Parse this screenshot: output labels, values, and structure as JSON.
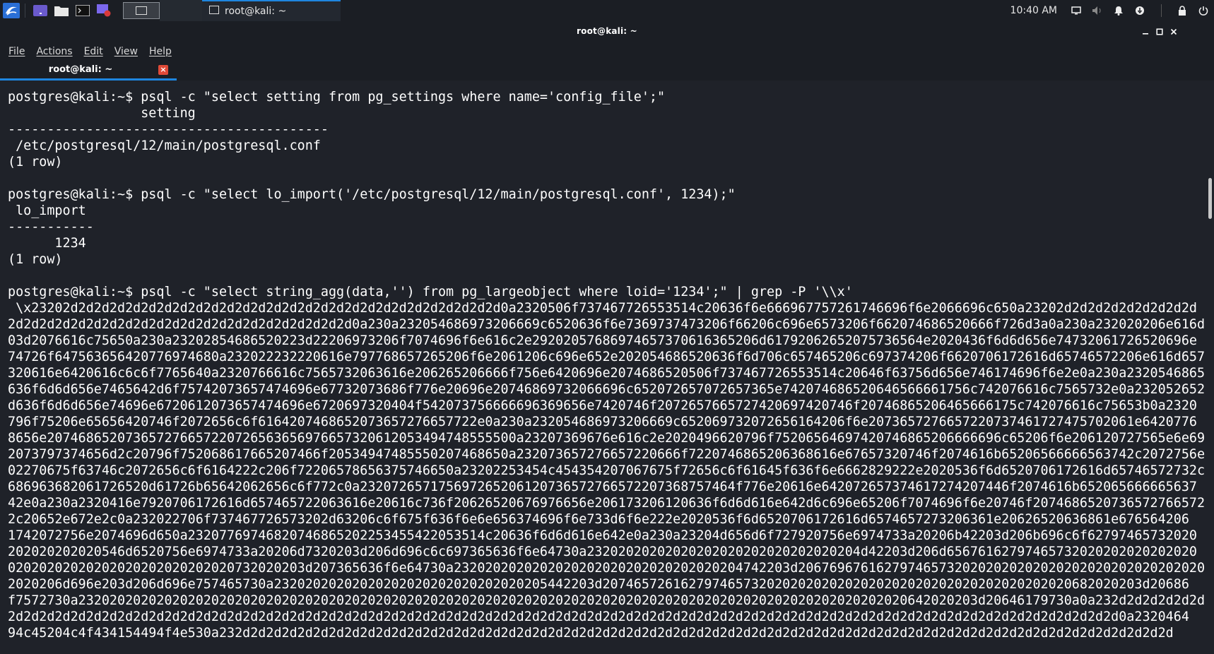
{
  "panel": {
    "clock": "10:40 AM",
    "taskbar_window_label": "root@kali: ~"
  },
  "window": {
    "title": "root@kali: ~"
  },
  "menu": {
    "items": [
      "File",
      "Actions",
      "Edit",
      "View",
      "Help"
    ]
  },
  "tab": {
    "label": "root@kali: ~",
    "close_glyph": "×"
  },
  "terminal": {
    "lines": [
      "postgres@kali:~$ psql -c \"select setting from pg_settings where name='config_file';\"",
      "                 setting",
      "-----------------------------------------",
      " /etc/postgresql/12/main/postgresql.conf",
      "(1 row)",
      "",
      "postgres@kali:~$ psql -c \"select lo_import('/etc/postgresql/12/main/postgresql.conf', 1234);\"",
      " lo_import",
      "-----------",
      "      1234",
      "(1 row)",
      "",
      "postgres@kali:~$ psql -c \"select string_agg(data,'') from pg_largeobject where loid='1234';\" | grep -P '\\\\x'",
      " \\x23202d2d2d2d2d2d2d2d2d2d2d2d2d2d2d2d2d2d2d2d2d2d2d2d2d2d2d2d0a2320506f737467726553514c20636f6e666967757261746696f6e2066696c650a23202d2d2d2d2d2d2d2d2d",
      "2d2d2d2d2d2d2d2d2d2d2d2d2d2d2d2d2d2d2d2d2d2d0a230a232054686973206669c6520636f6e7369737473206f66206c696e6573206f662074686520666f726d3a0a230a232020206e616d652",
      "03d2076616c75650a230a23202854686520223d22206973206f7074696f6e616c2e29202057686974657370616365206d61792062652075736564e2020436f6d6d656e74732061726520696e",
      "74726f647563656420776974680a232022232220616e797768657265206f6e2061206c696e652e202054686520636f6d706c657465206c697374206f6620706172616d65746572206e616d657",
      "320616e6420616c6c6f7765640a2320766616c7565732063616e206265206666f756e6420696e2074686520506f737467726553514c20646f63756d656e746174696f6e2e0a230a2320546865820",
      "636f6d6d656e7465642d6f75742073657474696e67732073686f776e20696e20746869732066696c652072657072657365e742074686520646566661756c742076616c7565732e0a232052652",
      "d636f6d6d656e74696e6720612073657474696e6720697320404f542073756666696369656e7420746f2072657665727420697420746f20746865206465666175c742076616c75653b0a2320",
      "796f75206e65656420746f2072656c6f6164207468652073657276657722e0a230a232054686973206669c652069732072656164206f6e2073657276657220737461727475702061e6420776",
      "8656e207468652073657276657220726563656976657320612053494748555500a23207369676e616c2e2020496620796f75206564697420746865206666696c65206f6e206120727565e6e696e67",
      "2073797374656d2c20796f752068617665207466f20534947485550207468650a232073657276657220666f7220746865206368616e67657320746f2074616b65206566666563742c2072756e2",
      "02270675f63746c2072656c6f6164222c206f72206578656375746650a23202253454c454354207067675f72656c6f61645f636f6e6662829222e2020536f6d6520706172616d65746572732c2077",
      "686963682061726520d61726b65642062656c6f772c0a232072657175697265206120736572766572207368757464f776e20616e642072657374617274207446f2074616b652065666665637",
      "42e0a230a2320416e7920706172616d657465722063616e20616c736f20626520676976656e206173206120636f6d6d616e642d6c696e65206f7074696f6e20746f20746865207365727665727",
      "2c20652e672e2c0a232022706f737467726573202d63206c6f675f636f6e6e656374696f6e733d6f6e222e2020536f6d6520706172616d6574657273206361e20626520636861e676564206",
      "1742072756e2074696d650a23207769746820746865202253455422053514c20636f6d6d616e642e0a230a23204d656d6f727920756e6974733a20206b42203d206b696c6f62797465732020",
      "202020202020546d6520756e6974733a20206d7320203d206d696c6c697365636f6e64730a23202020202020202020202020202020204d42203d206d65676162797465732020202020202020",
      "02020202020202020202020202020732020203d207365636f6e64730a2320202020202020202020202020202020204742203d2067696761627974657320202020202020202020202020202020",
      "2020206d696e203d206d696e757465730a23202020202020202020202020202020205442203d207465726162797465732020202020202020202020202020202020202020682020203d20686",
      "f7572730a2320202020202020202020202020202020202020202020202020202020202020202020202020202020202020202020202020202020642020203d20646179730a0a232d2d2d2d2d2d",
      "2d2d2d2d2d2d2d2d2d2d2d2d2d2d2d2d2d2d2d2d2d2d2d2d2d2d2d2d2d2d2d2d2d2d2d2d2d2d2d2d2d2d2d2d2d2d2d2d2d2d2d2d2d2d2d2d2d2d2d2d2d2d2d2d2d2d2d2d2d2d2d0a2320464",
      "94c45204c4f434154494f4e530a232d2d2d2d2d2d2d2d2d2d2d2d2d2d2d2d2d2d2d2d2d2d2d2d2d2d2d2d2d2d2d2d2d2d2d2d2d2d2d2d2d2d2d2d2d2d2d2d2d2d2d2d2d2d2d2d2d2d2d2d"
    ]
  }
}
